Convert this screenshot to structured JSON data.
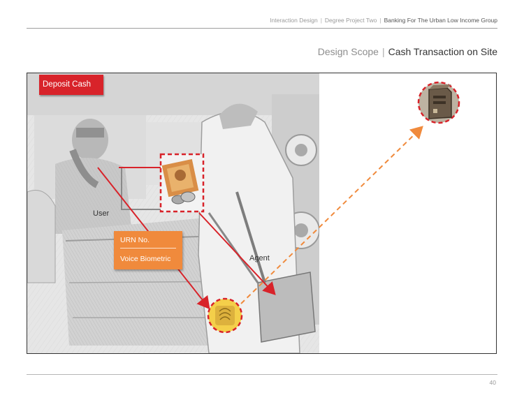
{
  "header": {
    "crumbs": [
      "Interaction Design",
      "Degree Project Two"
    ],
    "current": "Banking For The Urban Low Income Group",
    "separator": "|"
  },
  "scope": {
    "prefix": "Design Scope",
    "separator": "|",
    "title": "Cash Transaction on Site"
  },
  "illustration": {
    "deposit_label": "Deposit Cash",
    "user_label": "User",
    "agent_label": "Agent",
    "info_box": {
      "line1": "URN No.",
      "line2": "Voice Biometric"
    },
    "icons": [
      "photo-scene",
      "cash-icon",
      "fingerprint-device-icon",
      "bank-server-icon"
    ]
  },
  "colors": {
    "accent_red": "#d8232a",
    "accent_orange": "#f08a3c",
    "device_yellow": "#f4cf4a"
  },
  "footer": {
    "page_number": "40"
  }
}
